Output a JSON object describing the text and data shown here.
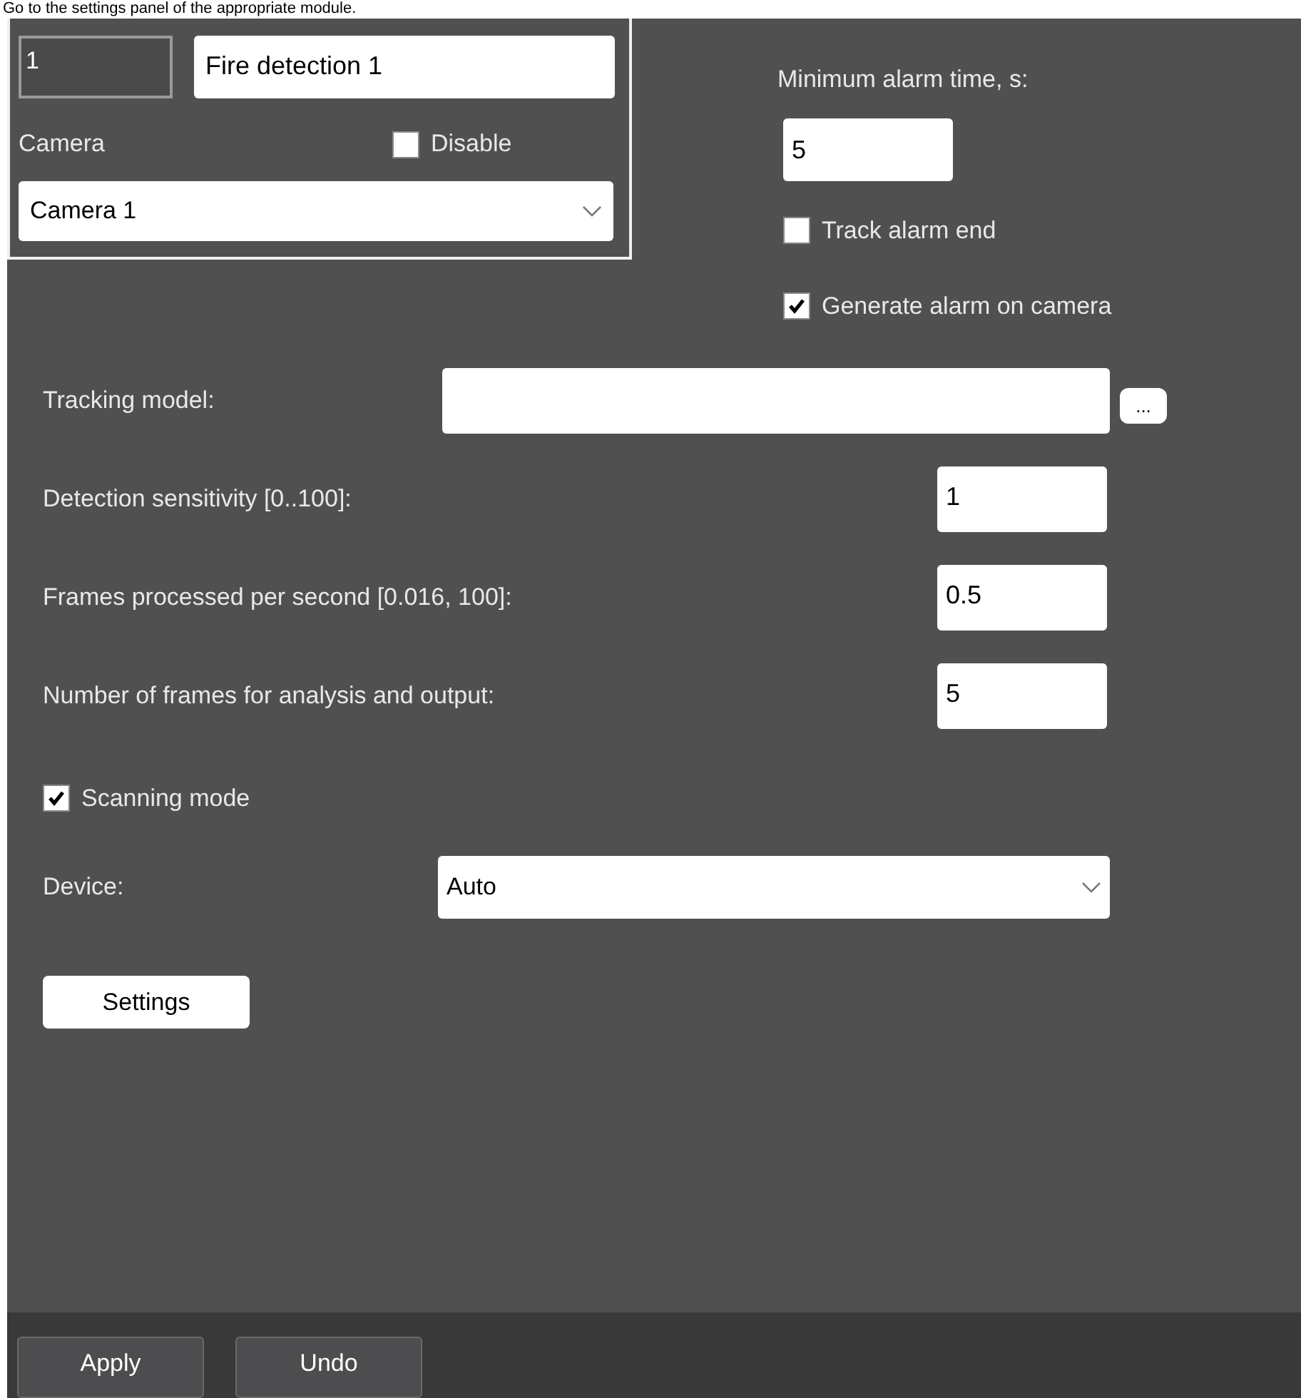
{
  "intro": "Go to the settings panel of the appropriate module.",
  "detector": {
    "id": "1",
    "name": "Fire detection 1",
    "camera_label": "Camera",
    "disable": {
      "label": "Disable",
      "checked": false
    },
    "camera": "Camera 1"
  },
  "alarm": {
    "label": "Minimum alarm time, s:",
    "value": "5"
  },
  "options": [
    {
      "label": "Track alarm end",
      "checked": false
    },
    {
      "label": "Generate alarm on camera",
      "checked": true
    }
  ],
  "tracking_model": {
    "label": "Tracking model:",
    "browse": "..."
  },
  "fields": [
    {
      "label": "Detection sensitivity [0..100]:",
      "value": "1"
    },
    {
      "label": "Frames processed per second [0.016, 100]:",
      "value": "0.5"
    },
    {
      "label": "Number of frames for analysis and output:",
      "value": "5"
    }
  ],
  "scanning_mode": {
    "label": "Scanning mode",
    "checked": true
  },
  "device": {
    "label": "Device:",
    "value": "Auto"
  },
  "settings_button": "Settings",
  "footer_buttons": [
    "Apply",
    "Undo"
  ]
}
